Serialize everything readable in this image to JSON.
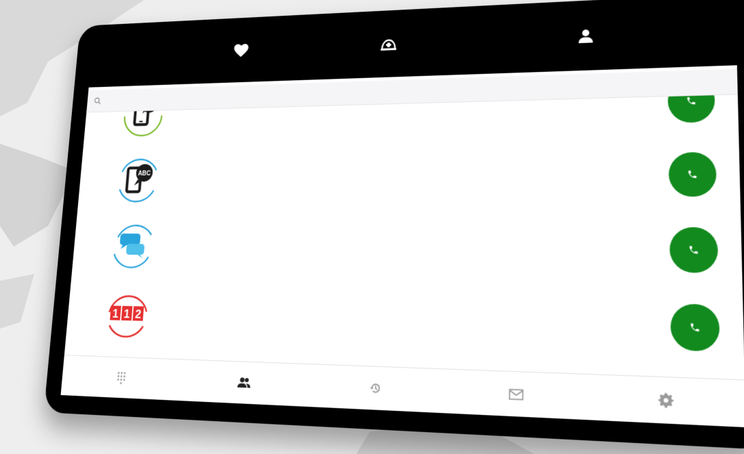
{
  "top_tabs": [
    {
      "id": "favorites",
      "icon": "heart-icon"
    },
    {
      "id": "emergency",
      "icon": "emergency-helmet-icon"
    },
    {
      "id": "profile",
      "icon": "person-icon"
    }
  ],
  "active_top_tab": "emergency",
  "search": {
    "placeholder": "",
    "value": ""
  },
  "contacts": [
    {
      "name": "",
      "logo": "sign-language-phone-logo",
      "accent": "#7dbb2f",
      "call_icon": "phone-icon"
    },
    {
      "name": "",
      "logo": "text-abc-phone-logo",
      "accent": "#2aa4dd",
      "call_icon": "phone-icon"
    },
    {
      "name": "",
      "logo": "chat-bubbles-logo",
      "accent": "#2aa4dd",
      "call_icon": "phone-icon"
    },
    {
      "name": "",
      "logo": "112-emergency-logo",
      "logo_text": [
        "1",
        "1",
        "2"
      ],
      "accent": "#e53030",
      "call_icon": "phone-icon"
    }
  ],
  "bottom_nav": [
    {
      "id": "dialpad",
      "icon": "dialpad-icon",
      "active": false
    },
    {
      "id": "contacts",
      "icon": "contacts-icon",
      "active": true
    },
    {
      "id": "history",
      "icon": "history-icon",
      "active": false
    },
    {
      "id": "messages",
      "icon": "mail-icon",
      "active": false
    },
    {
      "id": "settings",
      "icon": "gear-icon",
      "active": false
    }
  ],
  "colors": {
    "call_button": "#128a1e",
    "frame": "#000000",
    "nav_active": "#222222",
    "nav_inactive": "#9a9a9a",
    "logo_dark": "#1a1a1a"
  }
}
